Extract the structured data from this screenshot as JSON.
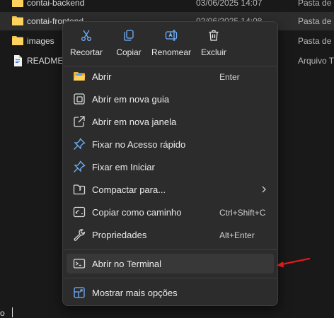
{
  "files": [
    {
      "name": "contai-backend",
      "date": "03/06/2025 14:07",
      "type": "Pasta de a",
      "icon": "folder-icon"
    },
    {
      "name": "contai-frontend",
      "date": "02/06/2025 14:08",
      "type": "Pasta de a",
      "icon": "folder-icon"
    },
    {
      "name": "images",
      "date": "",
      "type": "Pasta de a",
      "icon": "folder-icon"
    },
    {
      "name": "README",
      "date": "",
      "type": "Arquivo T",
      "icon": "document-icon"
    }
  ],
  "bottom_text": "o",
  "quick_actions": [
    {
      "label": "Recortar",
      "icon": "cut-icon"
    },
    {
      "label": "Copiar",
      "icon": "copy-icon"
    },
    {
      "label": "Renomear",
      "icon": "rename-icon"
    },
    {
      "label": "Excluir",
      "icon": "trash-icon"
    }
  ],
  "menu_items": [
    {
      "label": "Abrir",
      "shortcut": "Enter",
      "icon": "folder-open-icon"
    },
    {
      "label": "Abrir em nova guia",
      "shortcut": "",
      "icon": "new-tab-icon"
    },
    {
      "label": "Abrir em nova janela",
      "shortcut": "",
      "icon": "new-window-icon"
    },
    {
      "label": "Fixar no Acesso rápido",
      "shortcut": "",
      "icon": "pin-icon"
    },
    {
      "label": "Fixar em Iniciar",
      "shortcut": "",
      "icon": "pin-icon"
    },
    {
      "label": "Compactar para...",
      "shortcut": "",
      "icon": "zip-folder-icon",
      "submenu": true
    },
    {
      "label": "Copiar como caminho",
      "shortcut": "Ctrl+Shift+C",
      "icon": "copy-path-icon"
    },
    {
      "label": "Propriedades",
      "shortcut": "Alt+Enter",
      "icon": "wrench-icon"
    },
    {
      "label": "Abrir no Terminal",
      "shortcut": "",
      "icon": "terminal-icon"
    },
    {
      "label": "Mostrar mais opções",
      "shortcut": "",
      "icon": "more-options-icon"
    }
  ],
  "colors": {
    "accent": "#4ca0ff",
    "folder": "#f4c54a",
    "annotation_arrow": "#e0191b"
  }
}
